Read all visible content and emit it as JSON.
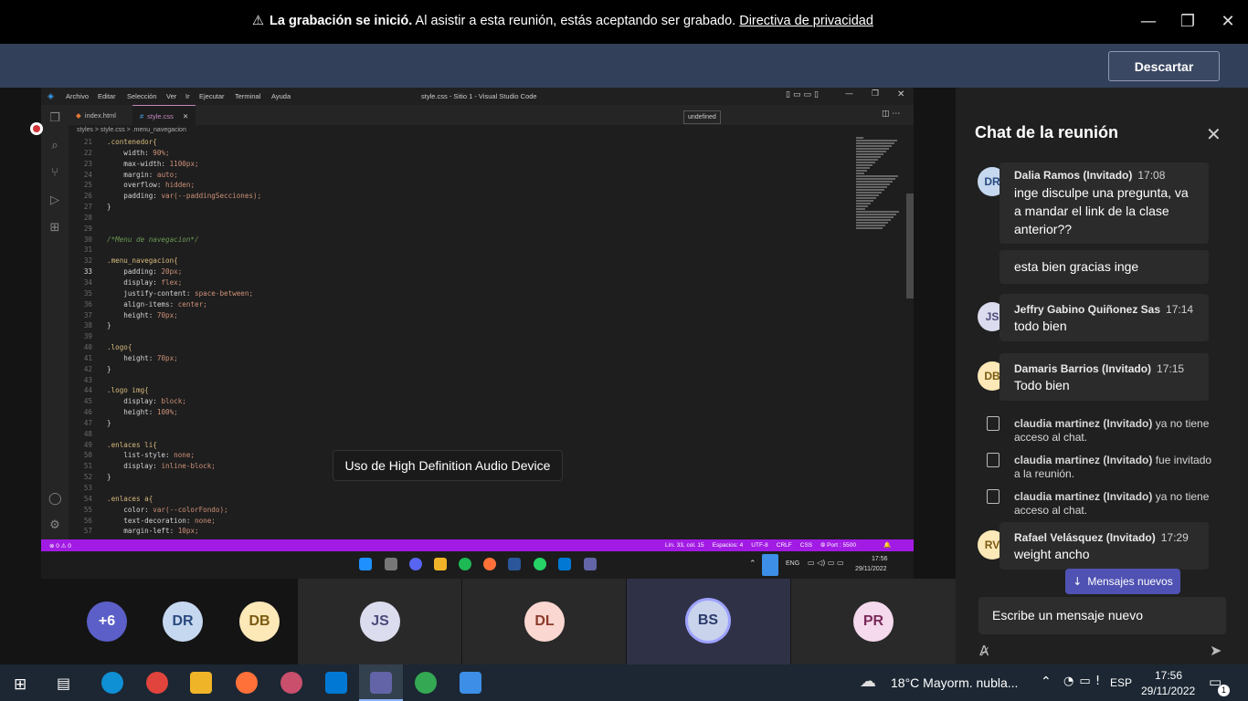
{
  "window": {
    "minimize_icon": "minimize-icon",
    "restore_icon": "restore-icon",
    "close_icon": "close-icon"
  },
  "banner": {
    "bold": "La grabación se inició.",
    "text": " Al asistir a esta reunión, estás aceptando ser grabado. ",
    "link": "Directiva de privacidad",
    "button": "Descartar"
  },
  "vscode": {
    "menu": [
      "Archivo",
      "Editar",
      "Selección",
      "Ver",
      "Ir",
      "Ejecutar",
      "Terminal",
      "Ayuda"
    ],
    "title": "style.css - Sitio 1 - Visual Studio Code",
    "tabs": [
      "index.html",
      "style.css"
    ],
    "breadcrumb": "styles > style.css > .menu_navegacion",
    "tooltip": "undefined",
    "status_left": "⊗ 0 ⚠ 0",
    "status_right": "Lín. 33, col. 15     Espacios: 4     UTF-8     CRLF     CSS     ⦾ Port : 5500",
    "clock_time": "17:56",
    "clock_date": "29/11/2022",
    "lang": "ENG"
  },
  "code": [
    {
      "n": "21",
      "t": ".contenedor{"
    },
    {
      "n": "22",
      "t": "    width: 90%;"
    },
    {
      "n": "23",
      "t": "    max-width: 1100px;"
    },
    {
      "n": "24",
      "t": "    margin: auto;"
    },
    {
      "n": "25",
      "t": "    overflow: hidden;"
    },
    {
      "n": "26",
      "t": "    padding: var(--paddingSecciones);"
    },
    {
      "n": "27",
      "t": "}"
    },
    {
      "n": "28",
      "t": ""
    },
    {
      "n": "29",
      "t": ""
    },
    {
      "n": "30",
      "t": "/*Menu de navegacion*/"
    },
    {
      "n": "31",
      "t": ""
    },
    {
      "n": "32",
      "t": ".menu_navegacion{"
    },
    {
      "n": "33",
      "t": "    padding: 20px;"
    },
    {
      "n": "34",
      "t": "    display: flex;"
    },
    {
      "n": "35",
      "t": "    justify-content: space-between;"
    },
    {
      "n": "36",
      "t": "    align-items: center;"
    },
    {
      "n": "37",
      "t": "    height: 70px;"
    },
    {
      "n": "38",
      "t": "}"
    },
    {
      "n": "39",
      "t": ""
    },
    {
      "n": "40",
      "t": ".logo{"
    },
    {
      "n": "41",
      "t": "    height: 70px;"
    },
    {
      "n": "42",
      "t": "}"
    },
    {
      "n": "43",
      "t": ""
    },
    {
      "n": "44",
      "t": ".logo img{"
    },
    {
      "n": "45",
      "t": "    display: block;"
    },
    {
      "n": "46",
      "t": "    height: 100%;"
    },
    {
      "n": "47",
      "t": "}"
    },
    {
      "n": "48",
      "t": ""
    },
    {
      "n": "49",
      "t": ".enlaces li{"
    },
    {
      "n": "50",
      "t": "    list-style: none;"
    },
    {
      "n": "51",
      "t": "    display: inline-block;"
    },
    {
      "n": "52",
      "t": "}"
    },
    {
      "n": "53",
      "t": ""
    },
    {
      "n": "54",
      "t": ".enlaces a{"
    },
    {
      "n": "55",
      "t": "    color: var(--colorFondo);"
    },
    {
      "n": "56",
      "t": "    text-decoration: none;"
    },
    {
      "n": "57",
      "t": "    margin-left: 10px;"
    }
  ],
  "toast": "Uso de High Definition Audio Device",
  "chat": {
    "title": "Chat de la reunión",
    "messages": [
      {
        "initials": "DR",
        "name": "Dalia Ramos (Invitado)",
        "time": "17:08",
        "text": "inge disculpe una pregunta, va a mandar el link de la clase anterior??"
      },
      {
        "text2": "esta bien gracias inge"
      },
      {
        "initials": "JS",
        "name": "Jeffry Gabino Quiñonez Sas",
        "time": "17:14",
        "text": "todo bien"
      },
      {
        "initials": "DB",
        "name": "Damaris Barrios (Invitado)",
        "time": "17:15",
        "text": "Todo bien"
      },
      {
        "initials": "RV",
        "name": "Rafael Velásquez (Invitado)",
        "time": "17:29",
        "text": "weight ancho"
      }
    ],
    "system": [
      {
        "bold": "claudia martinez (Invitado)",
        "rest": " ya no tiene acceso al chat."
      },
      {
        "bold": "claudia martinez (Invitado)",
        "rest": " fue invitado a la reunión."
      },
      {
        "bold": "claudia martinez (Invitado)",
        "rest": " ya no tiene acceso al chat."
      }
    ],
    "new_messages": "Mensajes nuevos",
    "compose_placeholder": "Escribe un mensaje nuevo"
  },
  "participants": [
    {
      "initials": "+6",
      "color": "#5b5fc7"
    },
    {
      "initials": "DR",
      "color": "#c6d8f0"
    },
    {
      "initials": "DB",
      "color": "#fde8b8"
    },
    {
      "initials": "JS",
      "color": "#dcdcef"
    },
    {
      "initials": "DL",
      "color": "#fad7d0"
    },
    {
      "initials": "BS",
      "color": "#c9d3ec"
    },
    {
      "initials": "PR",
      "color": "#f5d9ec"
    }
  ],
  "taskbar": {
    "weather": "18°C  Mayorm. nubla...",
    "lang": "ESP",
    "time": "17:56",
    "date": "29/11/2022",
    "notif": "1"
  }
}
